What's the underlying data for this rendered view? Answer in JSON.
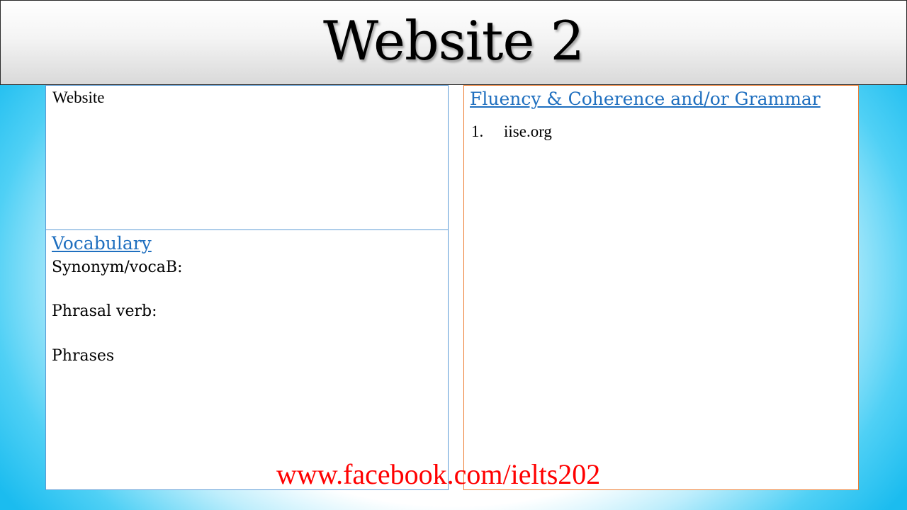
{
  "title": "Website 2",
  "website_panel": {
    "label": "Website"
  },
  "vocab_panel": {
    "heading": "Vocabulary",
    "lines": [
      "Synonym/vocaB:",
      "Phrasal verb:",
      "Phrases"
    ]
  },
  "fluency_panel": {
    "heading": "Fluency & Coherence and/or Grammar",
    "items": [
      {
        "number": "1.",
        "text": "iise.org"
      }
    ]
  },
  "footer": {
    "link": "www.facebook.com/ielts202"
  },
  "colors": {
    "heading": "#1f6fbf",
    "left_border": "#5b9bd5",
    "right_border": "#ed7d31",
    "footer_link": "#ff0000",
    "side_glow": "#1bbcef"
  }
}
